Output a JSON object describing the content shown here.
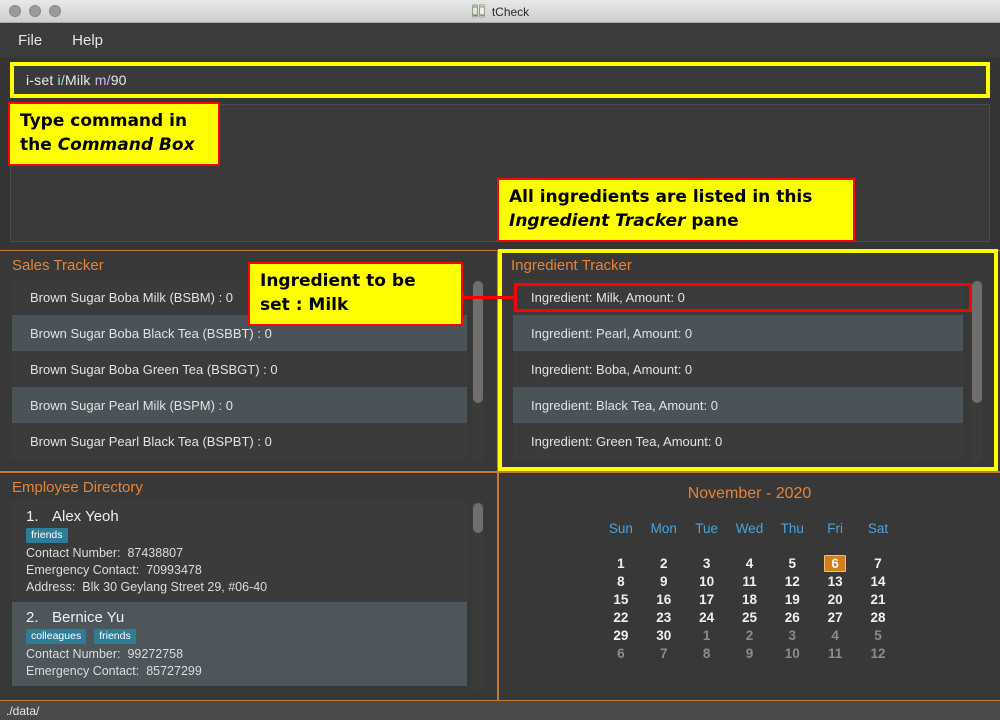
{
  "window": {
    "title": "tCheck",
    "title_icon": "boba-drink-icon",
    "traffic_lights": [
      "close",
      "minimize",
      "zoom"
    ]
  },
  "menubar": {
    "items": [
      {
        "label": "File"
      },
      {
        "label": "Help"
      }
    ]
  },
  "command_box": {
    "value": "i-set i/Milk m/90",
    "tokens": [
      {
        "text": "i-set ",
        "kind": "command"
      },
      {
        "text": "i/",
        "kind": "prefix-ingredient"
      },
      {
        "text": "Milk ",
        "kind": "value"
      },
      {
        "text": "m/",
        "kind": "prefix-amount"
      },
      {
        "text": "90",
        "kind": "value"
      }
    ]
  },
  "result_display": {
    "text": ""
  },
  "sales_tracker": {
    "title": "Sales Tracker",
    "rows": [
      "Brown Sugar Boba Milk (BSBM) : 0",
      "Brown Sugar Boba Black Tea (BSBBT) : 0",
      "Brown Sugar Boba Green Tea (BSBGT) : 0",
      "Brown Sugar Pearl Milk (BSPM) : 0",
      "Brown Sugar Pearl Black Tea (BSPBT) : 0"
    ]
  },
  "ingredient_tracker": {
    "title": "Ingredient Tracker",
    "rows": [
      "Ingredient: Milk,  Amount: 0",
      "Ingredient: Pearl,  Amount: 0",
      "Ingredient: Boba,  Amount: 0",
      "Ingredient: Black Tea,  Amount: 0",
      "Ingredient: Green Tea,  Amount: 0"
    ],
    "highlighted_row_index": 0
  },
  "employee_directory": {
    "title": "Employee Directory",
    "employees": [
      {
        "index": "1.",
        "name": "Alex Yeoh",
        "tags": [
          "friends"
        ],
        "contact_label": "Contact Number:",
        "contact_value": "87438807",
        "emergency_label": "Emergency Contact:",
        "emergency_value": "70993478",
        "address_label": "Address:",
        "address_value": "Blk 30 Geylang Street 29, #06-40"
      },
      {
        "index": "2.",
        "name": "Bernice Yu",
        "tags": [
          "colleagues",
          "friends"
        ],
        "contact_label": "Contact Number:",
        "contact_value": "99272758",
        "emergency_label": "Emergency Contact:",
        "emergency_value": "85727299",
        "address_label": "",
        "address_value": ""
      }
    ]
  },
  "calendar": {
    "title": "November - 2020",
    "weekdays": [
      "Sun",
      "Mon",
      "Tue",
      "Wed",
      "Thu",
      "Fri",
      "Sat"
    ],
    "weeks": [
      [
        {
          "d": "1",
          "dim": false,
          "sel": false
        },
        {
          "d": "2",
          "dim": false,
          "sel": false
        },
        {
          "d": "3",
          "dim": false,
          "sel": false
        },
        {
          "d": "4",
          "dim": false,
          "sel": false
        },
        {
          "d": "5",
          "dim": false,
          "sel": false
        },
        {
          "d": "6",
          "dim": false,
          "sel": true
        },
        {
          "d": "7",
          "dim": false,
          "sel": false
        }
      ],
      [
        {
          "d": "8",
          "dim": false,
          "sel": false
        },
        {
          "d": "9",
          "dim": false,
          "sel": false
        },
        {
          "d": "10",
          "dim": false,
          "sel": false
        },
        {
          "d": "11",
          "dim": false,
          "sel": false
        },
        {
          "d": "12",
          "dim": false,
          "sel": false
        },
        {
          "d": "13",
          "dim": false,
          "sel": false
        },
        {
          "d": "14",
          "dim": false,
          "sel": false
        }
      ],
      [
        {
          "d": "15",
          "dim": false,
          "sel": false
        },
        {
          "d": "16",
          "dim": false,
          "sel": false
        },
        {
          "d": "17",
          "dim": false,
          "sel": false
        },
        {
          "d": "18",
          "dim": false,
          "sel": false
        },
        {
          "d": "19",
          "dim": false,
          "sel": false
        },
        {
          "d": "20",
          "dim": false,
          "sel": false
        },
        {
          "d": "21",
          "dim": false,
          "sel": false
        }
      ],
      [
        {
          "d": "22",
          "dim": false,
          "sel": false
        },
        {
          "d": "23",
          "dim": false,
          "sel": false
        },
        {
          "d": "24",
          "dim": false,
          "sel": false
        },
        {
          "d": "25",
          "dim": false,
          "sel": false
        },
        {
          "d": "26",
          "dim": false,
          "sel": false
        },
        {
          "d": "27",
          "dim": false,
          "sel": false
        },
        {
          "d": "28",
          "dim": false,
          "sel": false
        }
      ],
      [
        {
          "d": "29",
          "dim": false,
          "sel": false
        },
        {
          "d": "30",
          "dim": false,
          "sel": false
        },
        {
          "d": "1",
          "dim": true,
          "sel": false
        },
        {
          "d": "2",
          "dim": true,
          "sel": false
        },
        {
          "d": "3",
          "dim": true,
          "sel": false
        },
        {
          "d": "4",
          "dim": true,
          "sel": false
        },
        {
          "d": "5",
          "dim": true,
          "sel": false
        }
      ],
      [
        {
          "d": "6",
          "dim": true,
          "sel": false
        },
        {
          "d": "7",
          "dim": true,
          "sel": false
        },
        {
          "d": "8",
          "dim": true,
          "sel": false
        },
        {
          "d": "9",
          "dim": true,
          "sel": false
        },
        {
          "d": "10",
          "dim": true,
          "sel": false
        },
        {
          "d": "11",
          "dim": true,
          "sel": false
        },
        {
          "d": "12",
          "dim": true,
          "sel": false
        }
      ]
    ],
    "selected_day": "6"
  },
  "status_bar": {
    "path": "./data/"
  },
  "annotations": [
    {
      "id": "command-box-callout",
      "line1": "Type command in",
      "line2_plain": "the ",
      "line2_italic": "Command Box"
    },
    {
      "id": "ingredient-tracker-callout",
      "line1": "All ingredients are listed in this",
      "line2_italic": "Ingredient Tracker",
      "line2_plain": " pane"
    },
    {
      "id": "ingredient-to-set-callout",
      "line1": "Ingredient to be",
      "line2_plain": "set : Milk"
    }
  ],
  "colors": {
    "accent_orange": "#e8833a",
    "pane_border": "#c77b30",
    "annotation_fill": "#ffff00",
    "annotation_border": "#ff0000",
    "tag_teal": "#2e7d96",
    "calendar_weekday": "#4aa3df",
    "calendar_selected": "#d2801e",
    "window_bg": "#353535"
  }
}
